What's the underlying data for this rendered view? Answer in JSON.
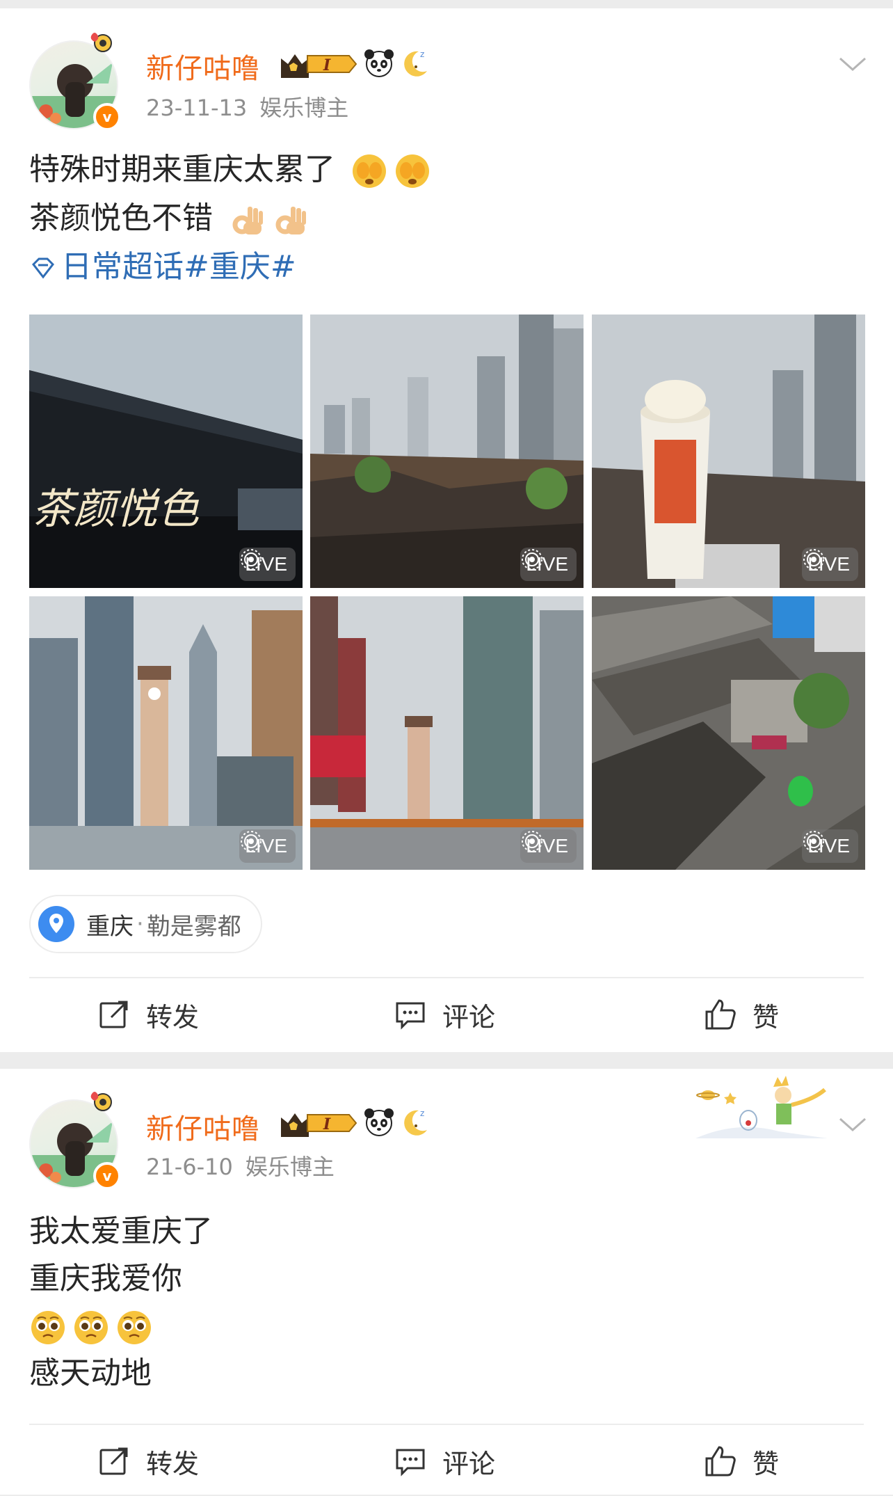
{
  "posts": [
    {
      "username": "新仔咕噜",
      "vip_level": "I",
      "date": "23-11-13",
      "category": "娱乐博主",
      "text_lines": [
        "特殊时期来重庆太累了",
        "茶颜悦色不错"
      ],
      "topic": "日常超话#重庆#",
      "images": [
        {
          "scene": "teashop-sign",
          "sign_text": "茶颜悦色",
          "badge": "LIVE"
        },
        {
          "scene": "city-rooftops",
          "badge": "LIVE"
        },
        {
          "scene": "drink-cup",
          "badge": "LIVE"
        },
        {
          "scene": "skyscrapers-tower",
          "badge": "LIVE"
        },
        {
          "scene": "plaza-tower",
          "badge": "LIVE"
        },
        {
          "scene": "old-rooftops",
          "badge": "LIVE"
        }
      ],
      "location": {
        "city": "重庆",
        "separator": "·",
        "place": "勒是雾都"
      },
      "actions": {
        "repost": "转发",
        "comment": "评论",
        "like": "赞"
      }
    },
    {
      "username": "新仔咕噜",
      "vip_level": "I",
      "date": "21-6-10",
      "category": "娱乐博主",
      "text_lines": [
        "我太爱重庆了",
        "重庆我爱你",
        "",
        "感天动地"
      ],
      "actions": {
        "repost": "转发",
        "comment": "评论",
        "like": "赞"
      }
    }
  ],
  "colors": {
    "username": "#f06b1b",
    "topic_link": "#2f6db5",
    "meta_gray": "#8d8d8d",
    "verified_badge": "#ff8200",
    "background": "#ececec"
  },
  "icons": [
    "chevron-down-icon",
    "emoji-sweat-icon",
    "emoji-ok-hand-icon",
    "emoji-pleading-icon",
    "supertopic-diamond-icon",
    "location-pin-icon",
    "repost-icon",
    "comment-icon",
    "like-icon",
    "live-photo-icon"
  ]
}
